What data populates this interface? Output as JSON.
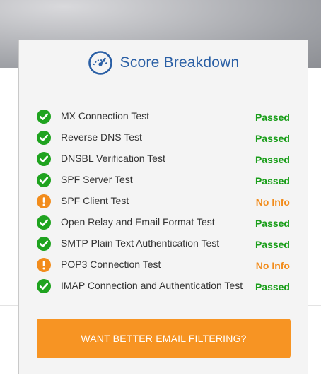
{
  "header": {
    "title": "Score Breakdown",
    "icon": "speedometer-icon"
  },
  "colors": {
    "title": "#2a5fa5",
    "passed": "#1a9e1a",
    "no_info": "#f28c1c",
    "button": "#f79423"
  },
  "tests": [
    {
      "name": "MX Connection Test",
      "status": "Passed",
      "state": "passed"
    },
    {
      "name": "Reverse DNS Test",
      "status": "Passed",
      "state": "passed"
    },
    {
      "name": "DNSBL Verification Test",
      "status": "Passed",
      "state": "passed"
    },
    {
      "name": "SPF Server Test",
      "status": "Passed",
      "state": "passed"
    },
    {
      "name": "SPF Client Test",
      "status": "No Info",
      "state": "warning"
    },
    {
      "name": "Open Relay and Email Format Test",
      "status": "Passed",
      "state": "passed"
    },
    {
      "name": "SMTP Plain Text Authentication Test",
      "status": "Passed",
      "state": "passed"
    },
    {
      "name": "POP3 Connection Test",
      "status": "No Info",
      "state": "warning"
    },
    {
      "name": "IMAP Connection and Authentication Test",
      "status": "Passed",
      "state": "passed"
    }
  ],
  "cta": {
    "label": "WANT BETTER EMAIL FILTERING?"
  }
}
